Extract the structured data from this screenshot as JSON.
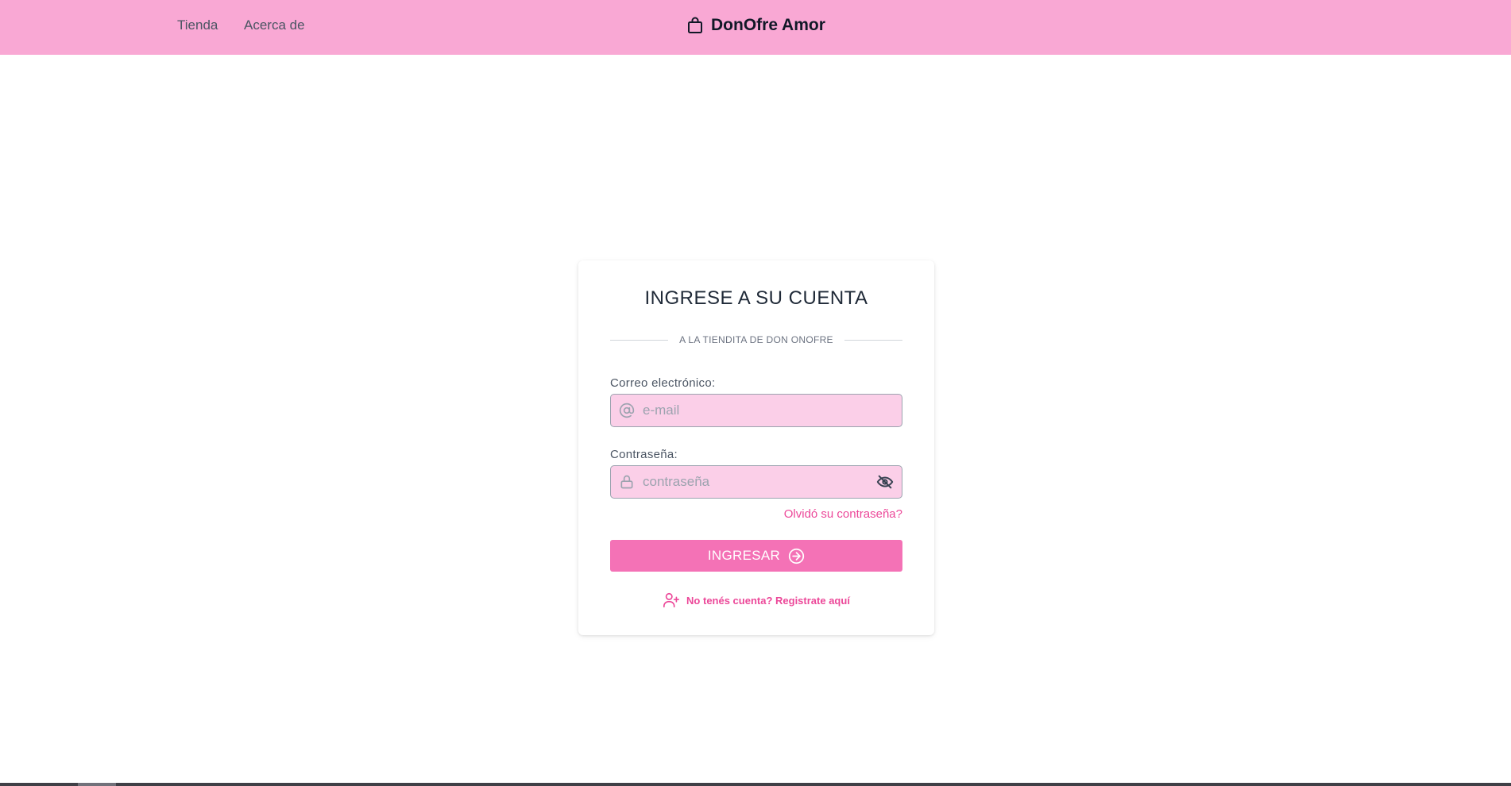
{
  "navbar": {
    "links": [
      "Tienda",
      "Acerca de"
    ],
    "brand": "DonOfre Amor",
    "brand_icon": "shopping-bag-icon",
    "background": "#f9a8d4"
  },
  "login": {
    "title": "INGRESE A SU CUENTA",
    "subtitle": "A LA TIENDITA DE DON ONOFRE",
    "email_label": "Correo electrónico:",
    "email_placeholder": "e-mail",
    "email_value": "",
    "password_label": "Contraseña:",
    "password_placeholder": "contraseña",
    "password_value": "",
    "forgot_link": "Olvidó su contraseña?",
    "submit_label": "INGRESAR",
    "register_link": "No tenés cuenta? Registrate aquí"
  },
  "icons": {
    "email": "at-sign-icon",
    "password": "lock-icon",
    "toggle": "eye-off-icon",
    "submit": "arrow-right-circle-icon",
    "register": "user-plus-icon"
  },
  "colors": {
    "accent": "#f472b6",
    "link": "#ec4899",
    "input_bg": "#fbcfe8"
  }
}
